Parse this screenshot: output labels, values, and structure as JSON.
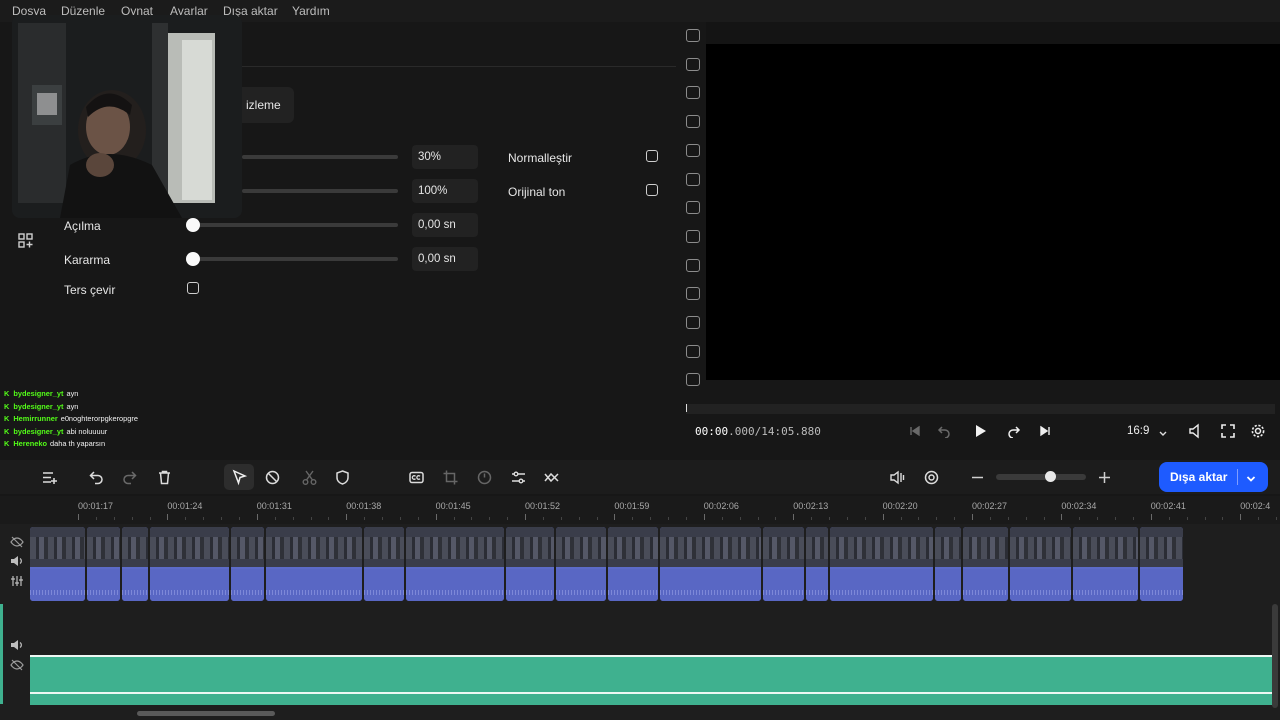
{
  "menu": [
    "Dosya",
    "Düzenle",
    "Oynat",
    "Ayarlar",
    "Dışa aktar",
    "Yardım"
  ],
  "panel": {
    "tab_partial": "izleme",
    "rows": [
      {
        "label": "",
        "value": "30%",
        "fill": 0.0
      },
      {
        "label": "",
        "value": "100%",
        "fill": 0.0
      },
      {
        "label": "Açılma",
        "value": "0,00 sn",
        "fill": 0.0
      },
      {
        "label": "Kararma",
        "value": "0,00 sn",
        "fill": 0.0
      }
    ],
    "reverse_label": "Ters çevir",
    "normalize_label": "Normalleştir",
    "original_tone_label": "Orijinal ton"
  },
  "chat": [
    {
      "user": "bydesigner_yt",
      "text": "ayn"
    },
    {
      "user": "bydesigner_yt",
      "text": "ayn"
    },
    {
      "user": "Hemirrunner",
      "text": "e0noghterorpgkeropgre"
    },
    {
      "user": "bydesigner_yt",
      "text": "abi noluuuur"
    },
    {
      "user": "Hereneko",
      "text": "daha th yaparsın"
    }
  ],
  "player": {
    "current_time": "00:00",
    "current_ms": ".000",
    "total_time": "/14:05.880",
    "aspect": "16:9"
  },
  "toolbar": {
    "export_label": "Dışa aktar",
    "zoom_level": 0.6
  },
  "timeline": {
    "ticks": [
      "00:01:17",
      "00:01:24",
      "00:01:31",
      "00:01:38",
      "00:01:45",
      "00:01:52",
      "00:01:59",
      "00:02:06",
      "00:02:13",
      "00:02:20",
      "00:02:27",
      "00:02:34",
      "00:02:41",
      "00:02:4"
    ]
  },
  "colors": {
    "accent": "#1e5bff",
    "video_clip": "#5c6bc8",
    "audio_clip": "#3fb18f",
    "chat_user": "#53fc18"
  }
}
